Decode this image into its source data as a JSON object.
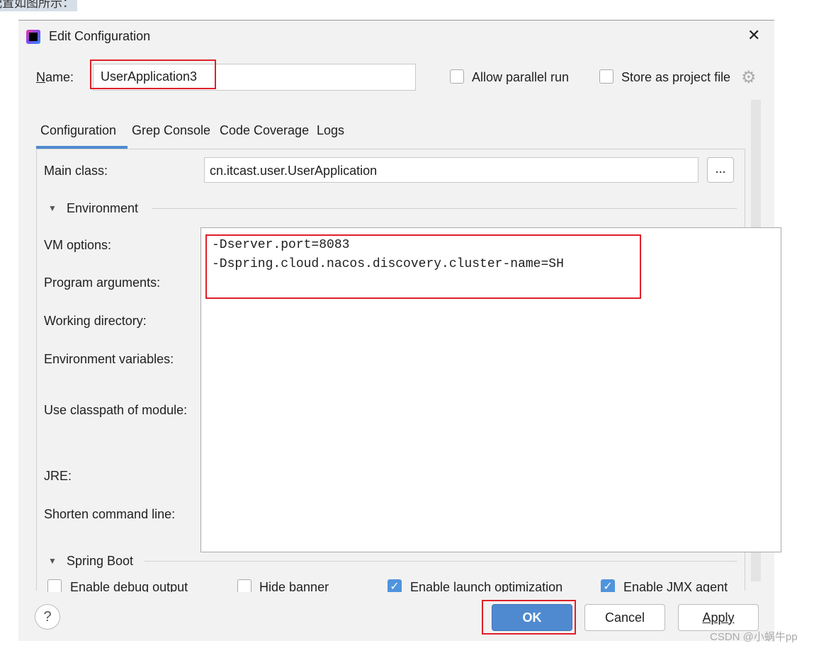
{
  "caption": "配置如图所示：",
  "dialog": {
    "title": "Edit Configuration",
    "close_icon": "close-icon"
  },
  "name": {
    "label": "Name:",
    "value": "UserApplication3"
  },
  "options": {
    "parallel": "Allow parallel run",
    "store": "Store as project file"
  },
  "tabs": [
    {
      "label": "Configuration",
      "active": true
    },
    {
      "label": "Grep Console"
    },
    {
      "label": "Code Coverage"
    },
    {
      "label": "Logs"
    }
  ],
  "form": {
    "main_class_label": "Main class:",
    "main_class_value": "cn.itcast.user.UserApplication",
    "browse": "...",
    "environment": "Environment",
    "vm_label": "VM options:",
    "vm_lines": [
      "-Dserver.port=8083",
      "-Dspring.cloud.nacos.discovery.cluster-name=SH"
    ],
    "program_args": "Program arguments:",
    "working_dir": "Working directory:",
    "env_vars": "Environment variables:",
    "classpath": "Use classpath of module:",
    "jre": "JRE:",
    "shorten": "Shorten command line:"
  },
  "spring_boot": {
    "title": "Spring Boot",
    "checks": [
      {
        "label": "Enable debug output",
        "checked": false
      },
      {
        "label": "Hide banner",
        "checked": false
      },
      {
        "label": "Enable launch optimization",
        "checked": true
      },
      {
        "label": "Enable JMX agent",
        "checked": true
      }
    ]
  },
  "buttons": {
    "help": "?",
    "ok": "OK",
    "cancel": "Cancel",
    "apply": "Apply"
  },
  "watermark": "CSDN @小蜗牛pp",
  "colors": {
    "accent": "#4f8ad0",
    "highlight": "#e0202a"
  }
}
